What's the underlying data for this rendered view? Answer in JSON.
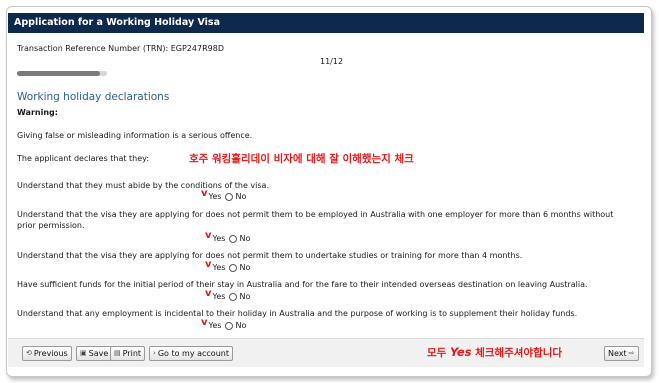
{
  "window": {
    "title": "Application for a Working Holiday Visa"
  },
  "header": {
    "trn": "Transaction Reference Number (TRN): EGP247R98D",
    "page_indicator": "11/12",
    "progress_fraction": 0.917
  },
  "section": {
    "title": "Working holiday declarations",
    "warning_label": "Warning:"
  },
  "intro": {
    "offence": "Giving false or misleading information is a serious offence.",
    "declares": "The applicant declares that they:"
  },
  "annotations": {
    "top": "호주 워킹홀리데이 비자에 대해 잘 이해했는지 체크",
    "bottom_prefix": "모두",
    "bottom_yes": "Yes",
    "bottom_suffix": "체크해주셔야합니다",
    "check_mark": "v"
  },
  "questions": [
    {
      "text": "Understand that they must abide by the conditions of the visa.",
      "yes": "Yes",
      "no": "No"
    },
    {
      "text": "Understand that the visa they are applying for does not permit them to be employed in Australia with one employer for more than 6 months without",
      "text2": "prior permission.",
      "yes": "Yes",
      "no": "No"
    },
    {
      "text": "Understand that the visa they are applying for does not permit them to undertake studies or training for more than 4 months.",
      "yes": "Yes",
      "no": "No"
    },
    {
      "text": "Have sufficient funds for the initial period of their stay in Australia and for the fare to their intended overseas destination on leaving Australia.",
      "yes": "Yes",
      "no": "No"
    },
    {
      "text": "Understand that any employment is incidental to their holiday in Australia and the purpose of working is to supplement their holiday funds.",
      "yes": "Yes",
      "no": "No"
    }
  ],
  "footer": {
    "previous": "Previous",
    "save": "Save",
    "print": "Print",
    "account": "Go to my account",
    "next": "Next"
  },
  "colors": {
    "titlebar": "#0d2a4d",
    "annotation": "#e11b1b",
    "section": "#2b5d8e"
  }
}
